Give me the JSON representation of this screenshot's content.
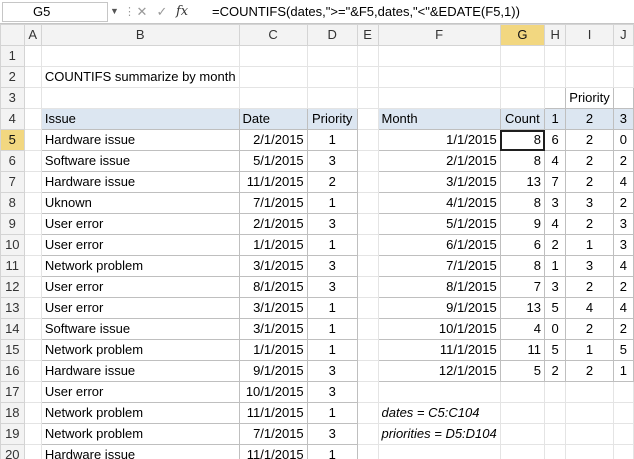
{
  "formula_bar": {
    "name_box": "G5",
    "cancel_icon": "✕",
    "enter_icon": "✓",
    "fx_label": "fx",
    "formula": "=COUNTIFS(dates,\">=\"&F5,dates,\"<\"&EDATE(F5,1))"
  },
  "columns": [
    "A",
    "B",
    "C",
    "D",
    "E",
    "F",
    "G",
    "H",
    "I",
    "J"
  ],
  "rows": [
    "1",
    "2",
    "3",
    "4",
    "5",
    "6",
    "7",
    "8",
    "9",
    "10",
    "11",
    "12",
    "13",
    "14",
    "15",
    "16",
    "17",
    "18",
    "19",
    "20"
  ],
  "title": "COUNTIFS summarize by month",
  "issues_table": {
    "headers": [
      "Issue",
      "Date",
      "Priority"
    ],
    "rows": [
      [
        "Hardware issue",
        "2/1/2015",
        "1"
      ],
      [
        "Software issue",
        "5/1/2015",
        "3"
      ],
      [
        "Hardware issue",
        "11/1/2015",
        "2"
      ],
      [
        "Uknown",
        "7/1/2015",
        "1"
      ],
      [
        "User error",
        "2/1/2015",
        "3"
      ],
      [
        "User error",
        "1/1/2015",
        "1"
      ],
      [
        "Network problem",
        "3/1/2015",
        "3"
      ],
      [
        "User error",
        "8/1/2015",
        "3"
      ],
      [
        "User error",
        "3/1/2015",
        "1"
      ],
      [
        "Software issue",
        "3/1/2015",
        "1"
      ],
      [
        "Network problem",
        "1/1/2015",
        "1"
      ],
      [
        "Hardware issue",
        "9/1/2015",
        "3"
      ],
      [
        "User error",
        "10/1/2015",
        "3"
      ],
      [
        "Network problem",
        "11/1/2015",
        "1"
      ],
      [
        "Network problem",
        "7/1/2015",
        "3"
      ],
      [
        "Hardware issue",
        "11/1/2015",
        "1"
      ]
    ]
  },
  "summary_table": {
    "priority_label": "Priority",
    "headers": [
      "Month",
      "Count",
      "1",
      "2",
      "3"
    ],
    "rows": [
      [
        "1/1/2015",
        "8",
        "6",
        "2",
        "0"
      ],
      [
        "2/1/2015",
        "8",
        "4",
        "2",
        "2"
      ],
      [
        "3/1/2015",
        "13",
        "7",
        "2",
        "4"
      ],
      [
        "4/1/2015",
        "8",
        "3",
        "3",
        "2"
      ],
      [
        "5/1/2015",
        "9",
        "4",
        "2",
        "3"
      ],
      [
        "6/1/2015",
        "6",
        "2",
        "1",
        "3"
      ],
      [
        "7/1/2015",
        "8",
        "1",
        "3",
        "4"
      ],
      [
        "8/1/2015",
        "7",
        "3",
        "2",
        "2"
      ],
      [
        "9/1/2015",
        "13",
        "5",
        "4",
        "4"
      ],
      [
        "10/1/2015",
        "4",
        "0",
        "2",
        "2"
      ],
      [
        "11/1/2015",
        "11",
        "5",
        "1",
        "5"
      ],
      [
        "12/1/2015",
        "5",
        "2",
        "2",
        "1"
      ]
    ]
  },
  "notes": {
    "dates": "dates = C5:C104",
    "priorities": "priorities = D5:D104"
  },
  "active_cell": "G5"
}
